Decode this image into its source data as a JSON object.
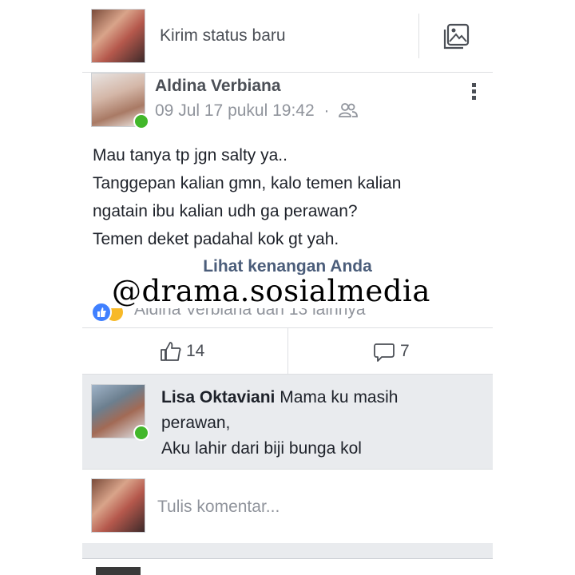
{
  "composer": {
    "placeholder": "Kirim status baru",
    "photo_icon": "photo-gallery-icon"
  },
  "post": {
    "author": "Aldina Verbiana",
    "date": "09 Jul 17 pukul 19:42",
    "separator": "·",
    "audience_icon": "friends-audience-icon",
    "more_icon": "more-vertical-icon",
    "text_lines": [
      "Mau tanya tp jgn salty ya..",
      "Tanggepan kalian gmn, kalo temen kalian",
      "ngatain ibu kalian udh ga perawan?",
      "Temen deket padahal kok gt yah."
    ],
    "memories_link": "Lihat kenangan Anda",
    "reactions_text": "Aldina Verbiana dan 13 lainnya",
    "like_count": "14",
    "comment_count": "7"
  },
  "watermark": "@drama.sosialmedia",
  "comment": {
    "author": "Lisa Oktaviani",
    "text_first": "Mama ku masih",
    "text_lines": [
      "perawan,",
      "Aku lahir dari biji bunga kol"
    ]
  },
  "reply": {
    "placeholder": "Tulis komentar..."
  },
  "colors": {
    "online": "#42b72a",
    "link": "#4b5d7a",
    "like_blue": "#4080ff",
    "haha_yellow": "#f7b928"
  }
}
